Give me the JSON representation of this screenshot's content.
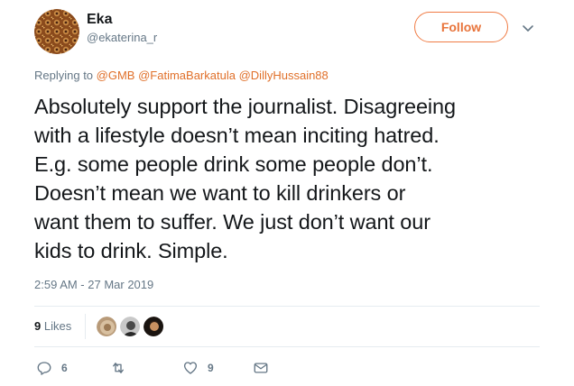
{
  "user": {
    "display_name": "Eka",
    "handle": "@ekaterina_r"
  },
  "header": {
    "follow_label": "Follow",
    "caret_icon": "chevron-down-icon"
  },
  "reply_context": {
    "prefix": "Replying to",
    "mentions": [
      "@GMB",
      "@FatimaBarkatula",
      "@DillyHussain88"
    ]
  },
  "tweet": {
    "lines": [
      "Absolutely support the journalist. Disagreeing",
      "with a lifestyle doesn’t mean inciting hatred.",
      "E.g. some people drink some people don’t.",
      "Doesn’t mean we want to kill drinkers or",
      "want them to suffer. We just don’t want our",
      "kids to drink. Simple."
    ],
    "timestamp": "2:59 AM - 27 Mar 2019"
  },
  "stats": {
    "likes_count": "9",
    "likes_label": "Likes"
  },
  "actions": {
    "reply_count": "6",
    "retweet_count": "",
    "like_count": "9"
  },
  "colors": {
    "accent": "#e8743b",
    "muted": "#657786",
    "text": "#14171a",
    "divider": "#e6ecf0"
  }
}
